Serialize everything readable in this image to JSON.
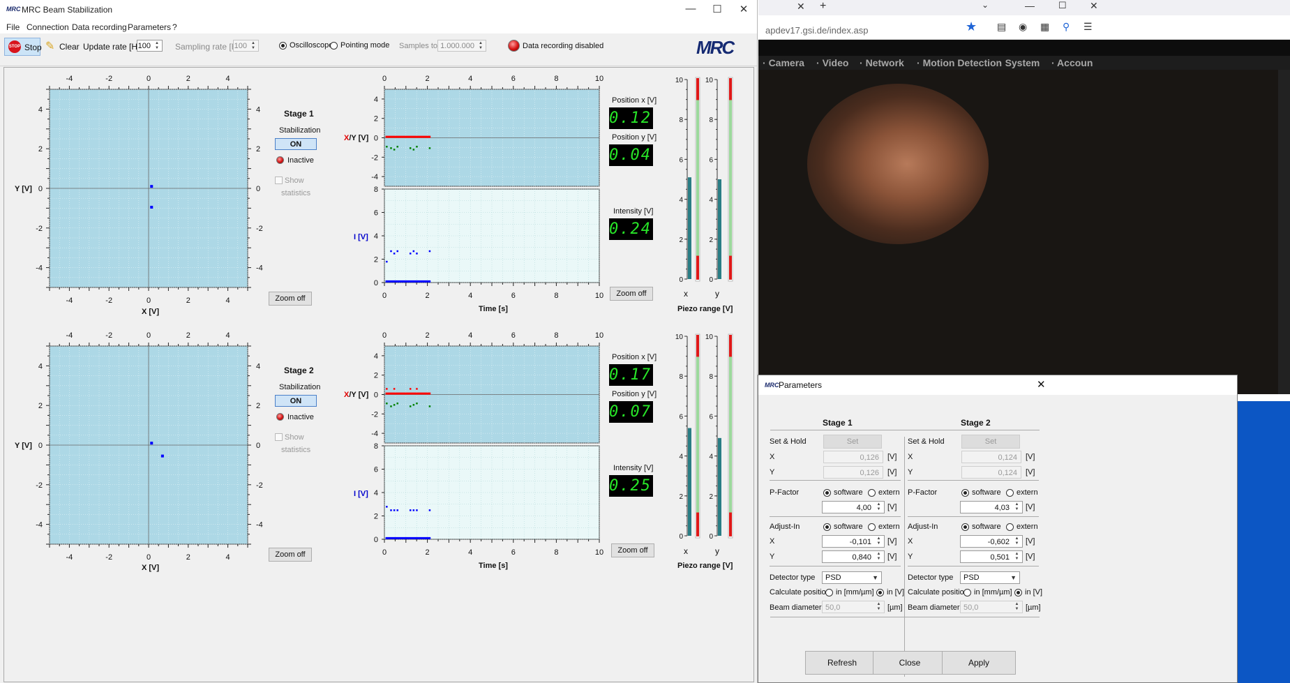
{
  "main_window": {
    "app_icon_text": "MRC",
    "title": "MRC Beam Stabilization",
    "menu": [
      "File",
      "Connection",
      "Data recording",
      "Parameters",
      "?"
    ],
    "toolbar": {
      "stop_label": "Stop",
      "stop_icon_text": "STOP",
      "clear_label": "Clear",
      "update_rate_label": "Update rate [Hz]",
      "update_rate_value": "100",
      "sampling_rate_label": "Sampling rate [Hz]",
      "sampling_rate_value": "100",
      "oscilloscope_label": "Oscilloscope",
      "pointing_mode_label": "Pointing mode",
      "samples_label": "Samples to take",
      "samples_value": "1.000.000",
      "recording_status": "Data recording disabled",
      "logo_text": "MRC",
      "oscilloscope_selected": true
    }
  },
  "stages": [
    {
      "title": "Stage 1",
      "stabilization_label": "Stabilization",
      "stabilization_state": "ON",
      "status": "Inactive",
      "show_statistics_line1": "Show",
      "show_statistics_line2": "statistics",
      "zoom_label": "Zoom off",
      "xy_points": [
        [
          0.15,
          0.1
        ],
        [
          0.15,
          -0.95
        ]
      ],
      "position_x_label": "Position x [V]",
      "position_x_value": "0.12",
      "position_y_label": "Position y [V]",
      "position_y_value": "0.04",
      "intensity_label": "Intensity [V]",
      "intensity_value": "0.24",
      "time_zoom_label": "Zoom off",
      "piezo_x_fraction": 0.51,
      "piezo_y_fraction": 0.5,
      "x_axis_label": "X [V]",
      "y_axis_label": "Y [V]",
      "xy_time_axis_label_prefix": "X",
      "xy_time_axis_label_sep": "/",
      "xy_time_axis_label_suffix": "Y [V]",
      "i_axis_label": "I [V]",
      "time_axis_label": "Time [s]",
      "piezo_label_x": "x",
      "piezo_label_y": "y",
      "piezo_range_label": "Piezo range [V]"
    },
    {
      "title": "Stage 2",
      "stabilization_label": "Stabilization",
      "stabilization_state": "ON",
      "status": "Inactive",
      "show_statistics_line1": "Show",
      "show_statistics_line2": "statistics",
      "zoom_label": "Zoom off",
      "xy_points": [
        [
          0.15,
          0.1
        ],
        [
          0.7,
          -0.55
        ]
      ],
      "position_x_label": "Position x [V]",
      "position_x_value": "0.17",
      "position_y_label": "Position y [V]",
      "position_y_value": "0.07",
      "intensity_label": "Intensity [V]",
      "intensity_value": "0.25",
      "time_zoom_label": "Zoom off",
      "piezo_x_fraction": 0.54,
      "piezo_y_fraction": 0.49,
      "x_axis_label": "X [V]",
      "y_axis_label": "Y [V]",
      "xy_time_axis_label_prefix": "X",
      "xy_time_axis_label_sep": "/",
      "xy_time_axis_label_suffix": "Y [V]",
      "i_axis_label": "I [V]",
      "time_axis_label": "Time [s]",
      "piezo_label_x": "x",
      "piezo_label_y": "y",
      "piezo_range_label": "Piezo range [V]"
    }
  ],
  "plot_axes": {
    "xy_ticks": [
      "-4",
      "-2",
      "0",
      "2",
      "4"
    ],
    "xy_ylim": [
      -5,
      5
    ],
    "time_ticks": [
      "0",
      "2",
      "4",
      "6",
      "8",
      "10"
    ],
    "time_xlim": [
      0,
      10
    ],
    "xy_time_yticks": [
      "4",
      "2",
      "0",
      "-2",
      "-4"
    ],
    "i_yticks": [
      "8",
      "6",
      "4",
      "2",
      "0"
    ],
    "piezo_ticks": [
      "10",
      "8",
      "6",
      "4",
      "2",
      "0"
    ]
  },
  "browser": {
    "url": "apdev17.gsi.de/index.asp",
    "nav_items": [
      "Camera",
      "Video",
      "Network",
      "Motion Detection",
      "System",
      "Accoun"
    ]
  },
  "params_dialog": {
    "app_icon_text": "MRC",
    "title": "Parameters",
    "close_label": "✕",
    "stages": [
      {
        "title": "Stage 1",
        "set_hold_label": "Set & Hold",
        "set_label": "Set",
        "x_label": "X",
        "x_value": "0,126",
        "y_label": "Y",
        "y_value": "0,126",
        "p_factor_label": "P-Factor",
        "software_label": "software",
        "extern_label": "extern",
        "p_factor_value": "4,00",
        "adjust_in_label": "Adjust-In",
        "adjust_x_value": "-0,101",
        "adjust_y_value": "0,840",
        "detector_label": "Detector type",
        "detector_value": "PSD",
        "calc_label": "Calculate position",
        "calc_mm_label": "in [mm/µm]",
        "calc_v_label": "in [V]",
        "beam_label": "Beam diameter",
        "beam_value": "50,0",
        "unit_v": "[V]",
        "unit_um": "[µm]"
      },
      {
        "title": "Stage 2",
        "set_hold_label": "Set & Hold",
        "set_label": "Set",
        "x_label": "X",
        "x_value": "0,124",
        "y_label": "Y",
        "y_value": "0,124",
        "p_factor_label": "P-Factor",
        "software_label": "software",
        "extern_label": "extern",
        "p_factor_value": "4,03",
        "adjust_in_label": "Adjust-In",
        "adjust_x_value": "-0,602",
        "adjust_y_value": "0,501",
        "detector_label": "Detector type",
        "detector_value": "PSD",
        "calc_label": "Calculate position",
        "calc_mm_label": "in [mm/µm]",
        "calc_v_label": "in [V]",
        "beam_label": "Beam diameter",
        "beam_value": "50,0",
        "unit_v": "[V]",
        "unit_um": "[µm]"
      }
    ],
    "buttons": [
      "Refresh",
      "Close",
      "Apply"
    ]
  },
  "colors": {
    "plot_bg": "#add8e6",
    "plot_bg_light": "#eaf8f8",
    "trace_red": "#ff0000",
    "trace_green": "#008000",
    "trace_blue": "#0000ff",
    "lcd_green": "#28e628",
    "piezo_teal": "#2a7d84",
    "piezo_red": "#e01818",
    "piezo_green": "#9cd99c"
  }
}
